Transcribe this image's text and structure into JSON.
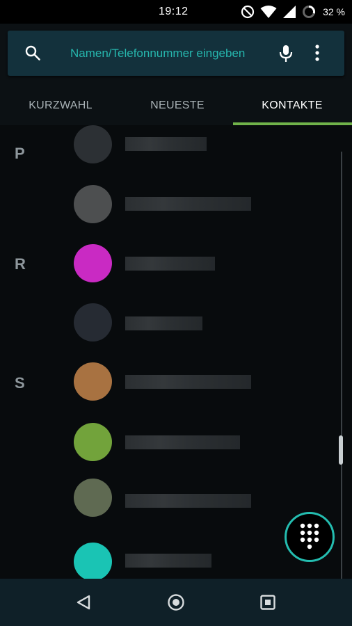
{
  "status_bar": {
    "time": "19:12",
    "battery_text": "32 %",
    "icons": [
      "do-not-disturb-icon",
      "wifi-icon",
      "cell-signal-icon",
      "battery-ring-icon"
    ]
  },
  "search": {
    "placeholder": "Namen/Telefonnummer eingeben",
    "icons": [
      "search-icon",
      "mic-icon",
      "more-vert-icon"
    ],
    "accent_color": "#26b7ae"
  },
  "tabs": [
    {
      "label": "KURZWAHL",
      "active": false
    },
    {
      "label": "NEUESTE",
      "active": false
    },
    {
      "label": "KONTAKTE",
      "active": true
    }
  ],
  "tab_indicator_color": "#71b34a",
  "section_letters": [
    "P",
    "R",
    "S"
  ],
  "contacts": [
    {
      "avatar_color": "#2c3034"
    },
    {
      "avatar_color": "#4d4f50"
    },
    {
      "avatar_color": "#c92ac3"
    },
    {
      "avatar_color": "#262b33"
    },
    {
      "avatar_color": "#a87241"
    },
    {
      "avatar_color": "#72a33b"
    },
    {
      "avatar_color": "#5f6a52"
    },
    {
      "avatar_color": "#1ac4b4"
    }
  ],
  "fab": {
    "icon": "dialpad-icon",
    "ring_color": "#24bdb0"
  },
  "nav_bar": {
    "icons": [
      "back-icon",
      "home-icon",
      "recents-icon"
    ]
  }
}
